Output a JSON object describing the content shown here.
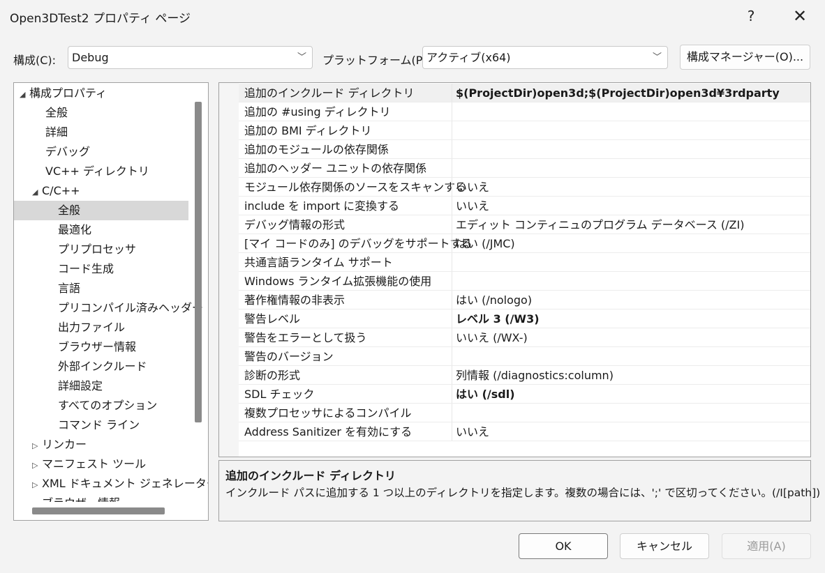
{
  "window": {
    "title": "Open3DTest2 プロパティ ページ",
    "help": "?",
    "close": "✕"
  },
  "toolbar": {
    "config_label": "構成(C):",
    "config_value": "Debug",
    "platform_label": "プラットフォーム(P):",
    "platform_value": "アクティブ(x64)",
    "manager_button": "構成マネージャー(O)..."
  },
  "tree": {
    "items": [
      {
        "label": "構成プロパティ",
        "arrow": "◢"
      },
      {
        "label": "全般"
      },
      {
        "label": "詳細"
      },
      {
        "label": "デバッグ"
      },
      {
        "label": "VC++ ディレクトリ"
      },
      {
        "label": "C/C++",
        "arrow": "◢"
      },
      {
        "label": "全般"
      },
      {
        "label": "最適化"
      },
      {
        "label": "プリプロセッサ"
      },
      {
        "label": "コード生成"
      },
      {
        "label": "言語"
      },
      {
        "label": "プリコンパイル済みヘッダー"
      },
      {
        "label": "出力ファイル"
      },
      {
        "label": "ブラウザー情報"
      },
      {
        "label": "外部インクルード"
      },
      {
        "label": "詳細設定"
      },
      {
        "label": "すべてのオプション"
      },
      {
        "label": "コマンド ライン"
      },
      {
        "label": "リンカー",
        "arrow": "▷"
      },
      {
        "label": "マニフェスト ツール",
        "arrow": "▷"
      },
      {
        "label": "XML ドキュメント ジェネレーター",
        "arrow": "▷"
      },
      {
        "label": "ブラウザー情報",
        "arrow": "▷"
      }
    ]
  },
  "grid": {
    "rows": [
      {
        "name": "追加のインクルード ディレクトリ",
        "value": "$(ProjectDir)open3d;$(ProjectDir)open3d¥3rdparty"
      },
      {
        "name": "追加の #using ディレクトリ",
        "value": ""
      },
      {
        "name": "追加の BMI ディレクトリ",
        "value": ""
      },
      {
        "name": "追加のモジュールの依存関係",
        "value": ""
      },
      {
        "name": "追加のヘッダー ユニットの依存関係",
        "value": ""
      },
      {
        "name": "モジュール依存関係のソースをスキャンする",
        "value": "いいえ"
      },
      {
        "name": "include を import に変換する",
        "value": "いいえ"
      },
      {
        "name": "デバッグ情報の形式",
        "value": "エディット コンティニュのプログラム データベース (/ZI)"
      },
      {
        "name": "[マイ コードのみ] のデバッグをサポートする",
        "value": "はい (/JMC)"
      },
      {
        "name": "共通言語ランタイム サポート",
        "value": ""
      },
      {
        "name": "Windows ランタイム拡張機能の使用",
        "value": ""
      },
      {
        "name": "著作権情報の非表示",
        "value": "はい (/nologo)"
      },
      {
        "name": "警告レベル",
        "value": "レベル 3 (/W3)"
      },
      {
        "name": "警告をエラーとして扱う",
        "value": "いいえ (/WX-)"
      },
      {
        "name": "警告のバージョン",
        "value": ""
      },
      {
        "name": "診断の形式",
        "value": "列情報 (/diagnostics:column)"
      },
      {
        "name": "SDL チェック",
        "value": "はい (/sdl)"
      },
      {
        "name": "複数プロセッサによるコンパイル",
        "value": ""
      },
      {
        "name": "Address Sanitizer を有効にする",
        "value": "いいえ"
      }
    ]
  },
  "description": {
    "title": "追加のインクルード ディレクトリ",
    "text": "インクルード パスに追加する 1 つ以上のディレクトリを指定します。複数の場合には、';' で区切ってください。(/I[path])"
  },
  "buttons": {
    "ok": "OK",
    "cancel": "キャンセル",
    "apply": "適用(A)"
  }
}
